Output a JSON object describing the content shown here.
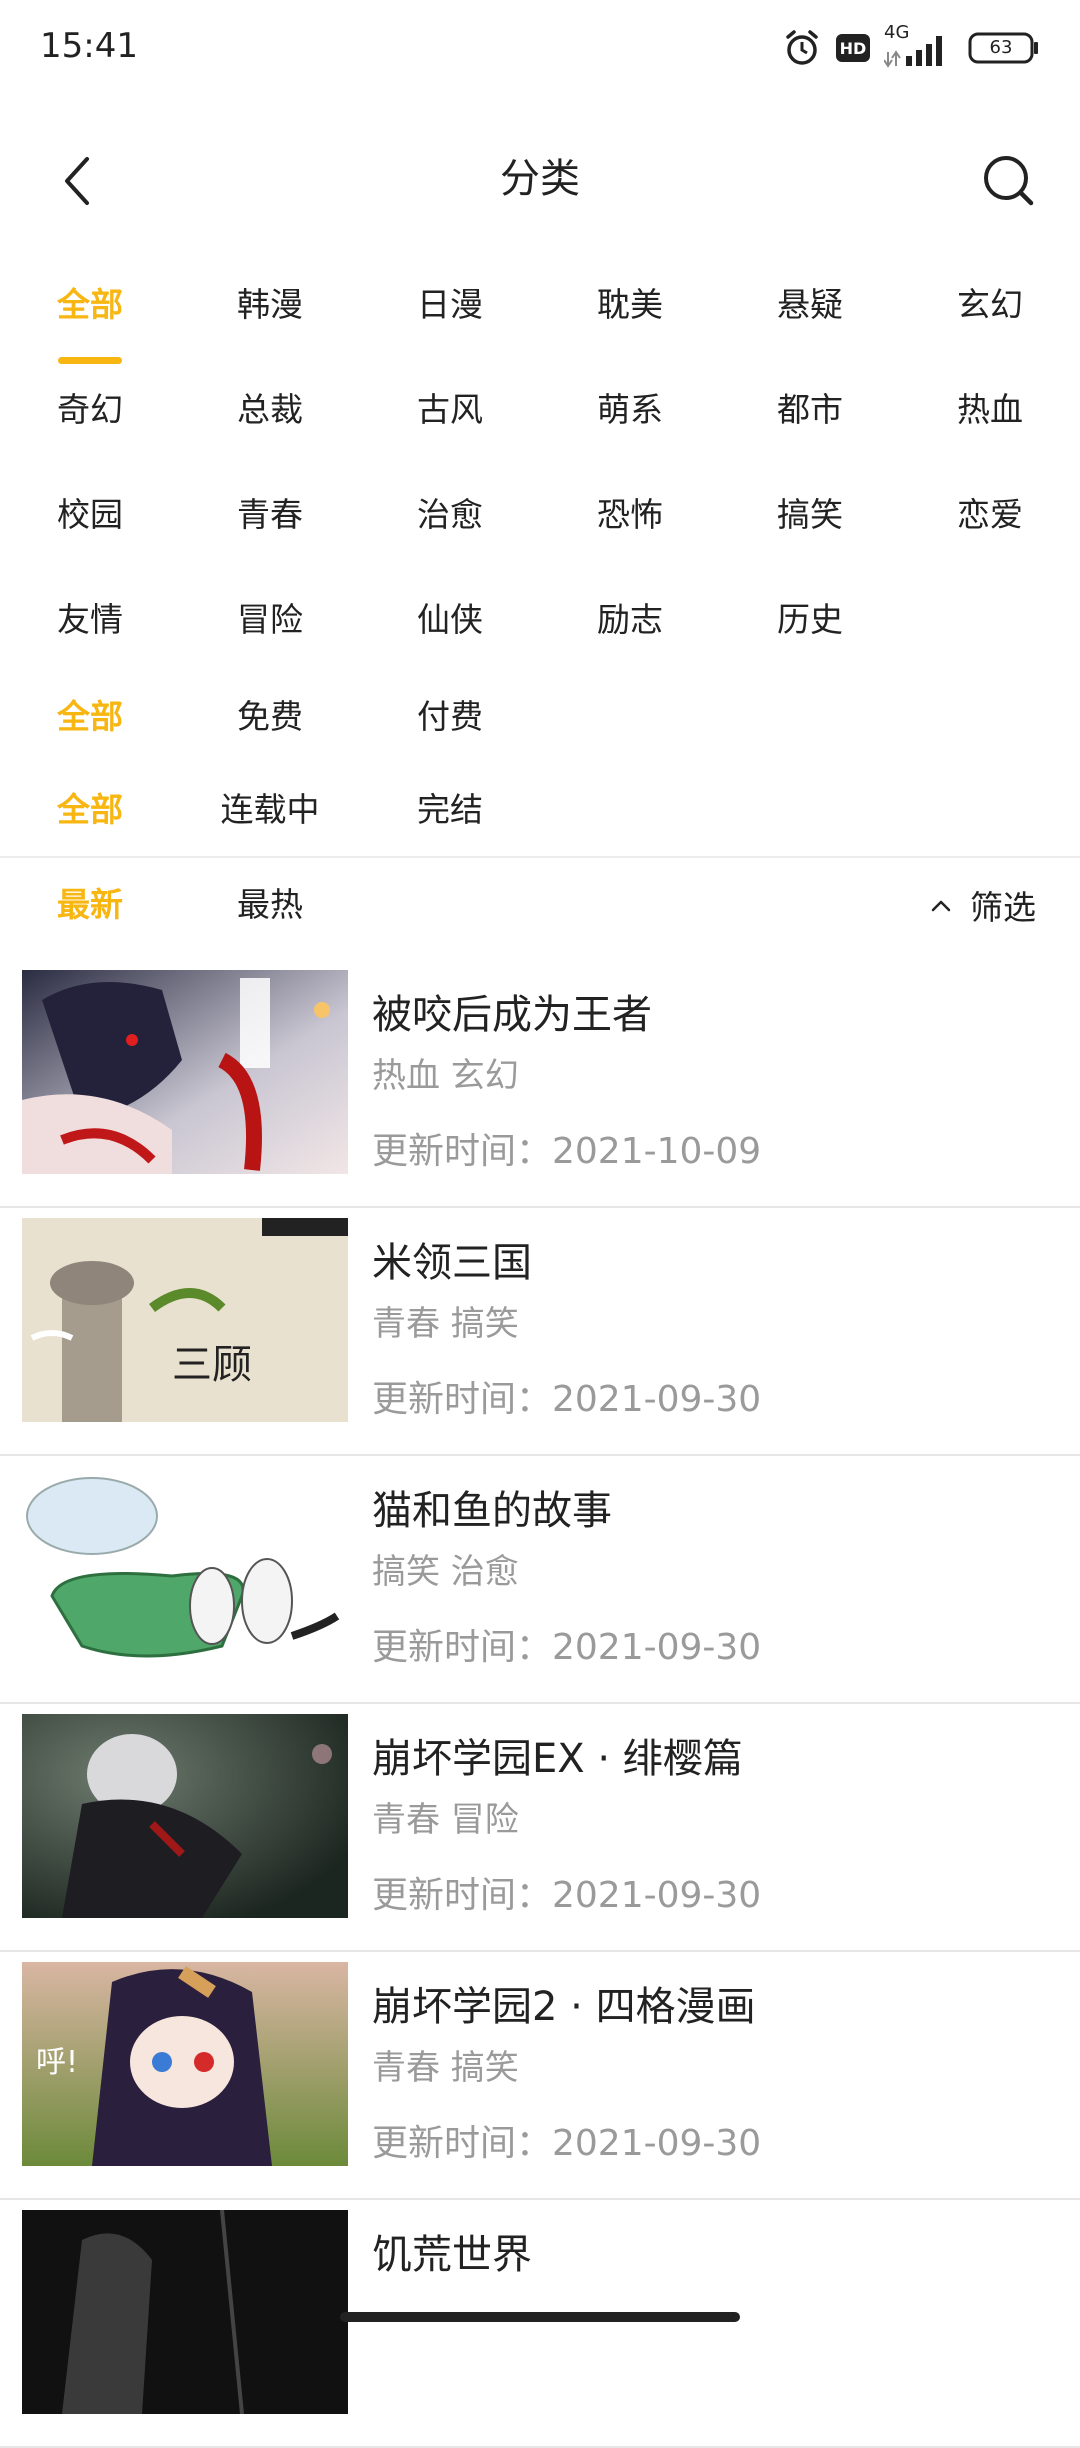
{
  "status_bar": {
    "time": "15:41",
    "network": "4G",
    "hd": "HD",
    "battery": "63"
  },
  "header": {
    "title": "分类"
  },
  "filters": {
    "genres": [
      {
        "label": "全部",
        "active": true
      },
      {
        "label": "韩漫",
        "active": false
      },
      {
        "label": "日漫",
        "active": false
      },
      {
        "label": "耽美",
        "active": false
      },
      {
        "label": "悬疑",
        "active": false
      },
      {
        "label": "玄幻",
        "active": false
      },
      {
        "label": "奇幻",
        "active": false
      },
      {
        "label": "总裁",
        "active": false
      },
      {
        "label": "古风",
        "active": false
      },
      {
        "label": "萌系",
        "active": false
      },
      {
        "label": "都市",
        "active": false
      },
      {
        "label": "热血",
        "active": false
      },
      {
        "label": "校园",
        "active": false
      },
      {
        "label": "青春",
        "active": false
      },
      {
        "label": "治愈",
        "active": false
      },
      {
        "label": "恐怖",
        "active": false
      },
      {
        "label": "搞笑",
        "active": false
      },
      {
        "label": "恋爱",
        "active": false
      },
      {
        "label": "友情",
        "active": false
      },
      {
        "label": "冒险",
        "active": false
      },
      {
        "label": "仙侠",
        "active": false
      },
      {
        "label": "励志",
        "active": false
      },
      {
        "label": "历史",
        "active": false
      }
    ],
    "price": [
      {
        "label": "全部",
        "active": true
      },
      {
        "label": "免费",
        "active": false
      },
      {
        "label": "付费",
        "active": false
      }
    ],
    "status": [
      {
        "label": "全部",
        "active": true
      },
      {
        "label": "连载中",
        "active": false
      },
      {
        "label": "完结",
        "active": false
      }
    ]
  },
  "sort": {
    "options": [
      {
        "label": "最新",
        "active": true
      },
      {
        "label": "最热",
        "active": false
      }
    ],
    "filter_label": "筛选"
  },
  "comics": [
    {
      "title": "被咬后成为王者",
      "tags": "热血 玄幻",
      "updated": "更新时间：2021-10-09"
    },
    {
      "title": "米领三国",
      "tags": "青春 搞笑",
      "updated": "更新时间：2021-09-30"
    },
    {
      "title": "猫和鱼的故事",
      "tags": "搞笑 治愈",
      "updated": "更新时间：2021-09-30"
    },
    {
      "title": "崩坏学园EX · 绯樱篇",
      "tags": "青春 冒险",
      "updated": "更新时间：2021-09-30"
    },
    {
      "title": "崩坏学园2 · 四格漫画",
      "tags": "青春 搞笑",
      "updated": "更新时间：2021-09-30"
    },
    {
      "title": "饥荒世界",
      "tags": "",
      "updated": ""
    }
  ],
  "colors": {
    "accent": "#F7B611",
    "text": "#222222",
    "muted": "#9a9a9a"
  }
}
